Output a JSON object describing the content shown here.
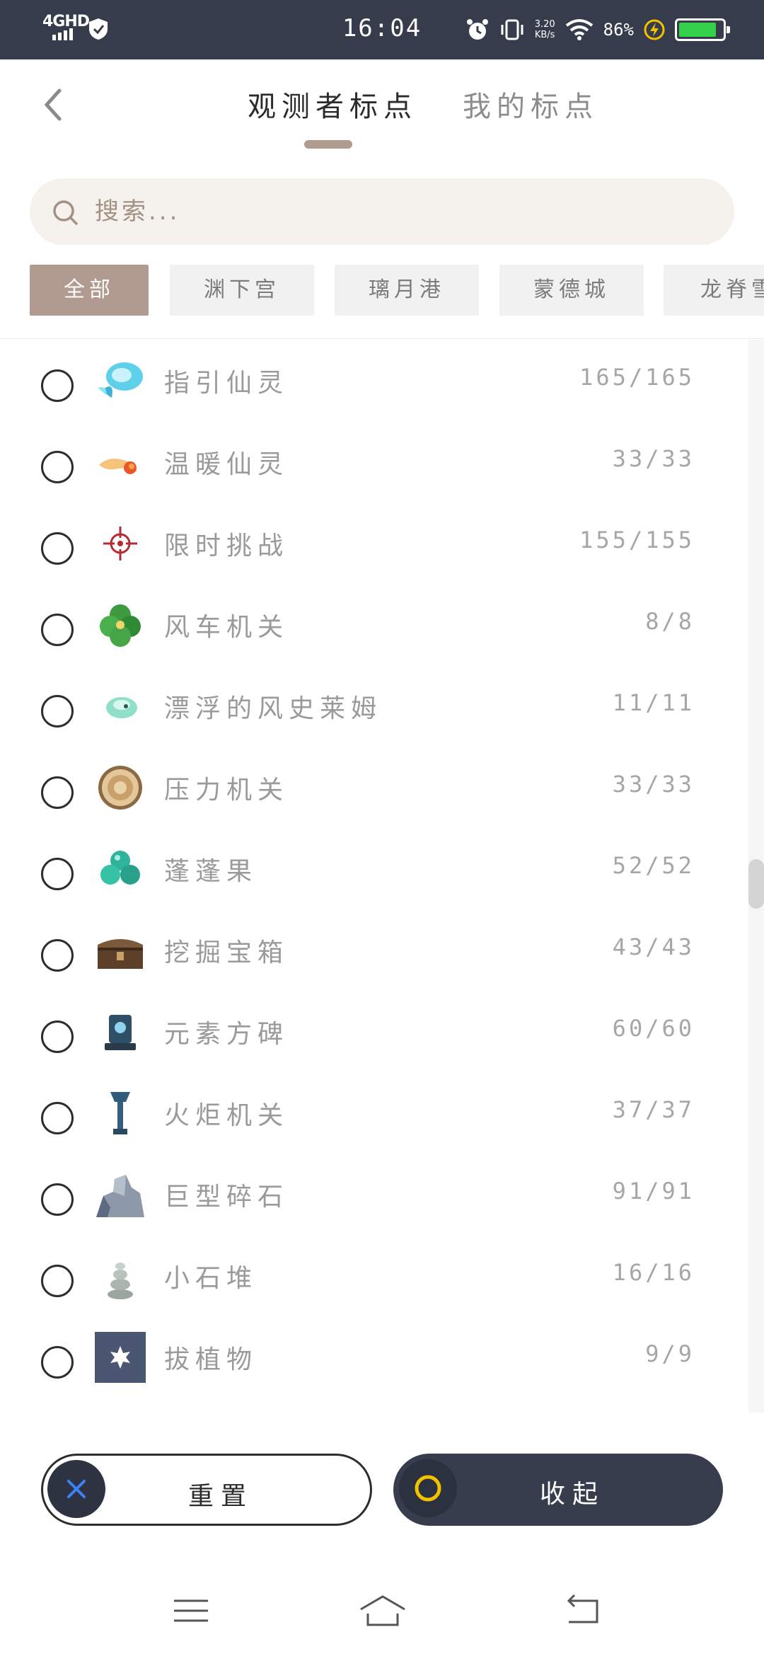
{
  "status_bar": {
    "network": "4GHD",
    "time": "16:04",
    "speed_value": "3.20",
    "speed_unit": "KB/s",
    "battery_percent": "86%",
    "battery_level": 0.86
  },
  "header": {
    "tabs": [
      {
        "label": "观测者标点",
        "active": true
      },
      {
        "label": "我的标点",
        "active": false
      }
    ]
  },
  "search": {
    "placeholder": "搜索..."
  },
  "filters": [
    {
      "label": "全部",
      "active": true
    },
    {
      "label": "渊下宫",
      "active": false
    },
    {
      "label": "璃月港",
      "active": false
    },
    {
      "label": "蒙德城",
      "active": false
    },
    {
      "label": "龙脊雪山",
      "active": false
    }
  ],
  "items": [
    {
      "label": "指引仙灵",
      "count": "165/165",
      "icon": "guide-seelie-icon"
    },
    {
      "label": "温暖仙灵",
      "count": "33/33",
      "icon": "warming-seelie-icon"
    },
    {
      "label": "限时挑战",
      "count": "155/155",
      "icon": "timed-challenge-icon"
    },
    {
      "label": "风车机关",
      "count": "8/8",
      "icon": "windmill-mechanism-icon"
    },
    {
      "label": "漂浮的风史莱姆",
      "count": "11/11",
      "icon": "floating-anemo-slime-icon"
    },
    {
      "label": "压力机关",
      "count": "33/33",
      "icon": "pressure-plate-icon"
    },
    {
      "label": "蓬蓬果",
      "count": "52/52",
      "icon": "bloatty-floatty-icon"
    },
    {
      "label": "挖掘宝箱",
      "count": "43/43",
      "icon": "buried-chest-icon"
    },
    {
      "label": "元素方碑",
      "count": "60/60",
      "icon": "elemental-monument-icon"
    },
    {
      "label": "火炬机关",
      "count": "37/37",
      "icon": "torch-mechanism-icon"
    },
    {
      "label": "巨型碎石",
      "count": "91/91",
      "icon": "large-rock-pile-icon"
    },
    {
      "label": "小石堆",
      "count": "16/16",
      "icon": "small-rock-pile-icon"
    },
    {
      "label": "拔植物",
      "count": "9/9",
      "icon": "pluckable-plant-icon"
    }
  ],
  "buttons": {
    "reset": "重置",
    "collapse": "收起"
  },
  "colors": {
    "accent": "#b19b91",
    "status_bar": "#363c4c",
    "dark_button": "#373d4d",
    "battery_green": "#34d14a",
    "close_x": "#3b82f6",
    "ring_yellow": "#f2c200"
  }
}
